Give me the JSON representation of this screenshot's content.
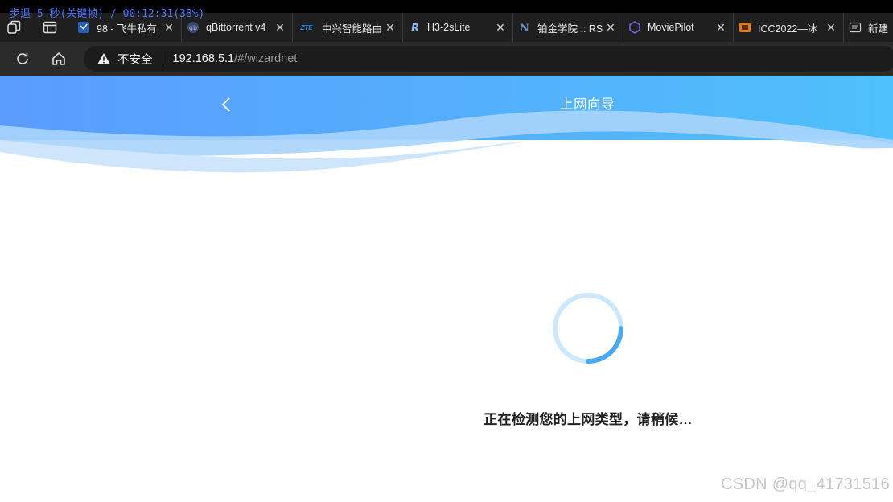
{
  "overlay": {
    "text": "步退 5 秒(关键帧) / 00:12:31(38%)"
  },
  "browser": {
    "tabs": [
      {
        "title": "98 - 飞牛私有",
        "icon": "blue-doc-icon"
      },
      {
        "title": "qBittorrent v4",
        "icon": "qbittorrent-icon"
      },
      {
        "title": "中兴智能路由",
        "icon": "zte-icon",
        "favicon_text": "ZTE"
      },
      {
        "title": "H3-2sLite",
        "icon": "r-logo-icon"
      },
      {
        "title": "铂金学院 :: RS",
        "icon": "n-logo-icon"
      },
      {
        "title": "MoviePilot",
        "icon": "moviepilot-icon"
      },
      {
        "title": "ICC2022—冰",
        "icon": "orange-icon"
      },
      {
        "title": "新建",
        "icon": "new-tab-page-icon"
      }
    ],
    "address": {
      "security_label": "不安全",
      "host": "192.168.5.1",
      "path": "/#/wizardnet"
    }
  },
  "page": {
    "title": "上网向导",
    "status": "正在检测您的上网类型，请稍候…",
    "spinner_progress": 0.25,
    "colors": {
      "header_start": "#5a9cff",
      "header_end": "#4fc0fb",
      "spinner": "#4aa8f4",
      "spinner_track": "#cde8fd"
    }
  },
  "watermark": "CSDN @qq_41731516"
}
